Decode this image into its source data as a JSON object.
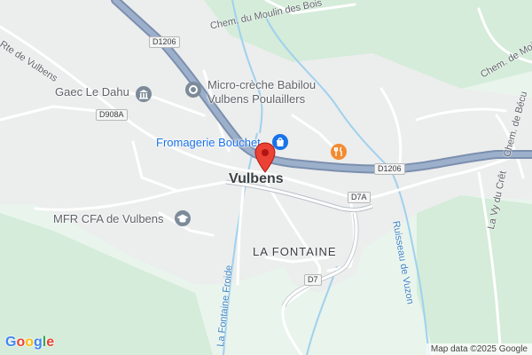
{
  "map": {
    "places": {
      "town": "Vulbens",
      "district": "LA FONTAINE"
    },
    "pois": {
      "gaec": "Gaec Le Dahu",
      "creche_line1": "Micro-crèche Babilou",
      "creche_line2": "Vulbens Poulaillers",
      "fromagerie": "Fromagerie Bouchet",
      "mfr": "MFR CFA de Vulbens"
    },
    "streets": {
      "rte_vulbens": "Rte de Vulbens",
      "moulin": "Chem. du Moulin des Bois",
      "moissey": "Chem. de Moissey",
      "becu": "Chem. de Bécu",
      "vy_cret": "La Vy du Crêt"
    },
    "waterways": {
      "ruisseau_vuzon": "Ruisseau de Vuzon",
      "fontaine_froide": "La Fontaine Froide"
    },
    "road_shields": {
      "d1206_top": "D1206",
      "d1206_right": "D1206",
      "d908a": "D908A",
      "d7a": "D7A",
      "d7": "D7"
    },
    "icons": {
      "gaec": "museum-icon",
      "creche": "place-icon",
      "fromagerie": "shopping-bag-icon",
      "restaurant": "restaurant-icon",
      "mfr": "school-icon",
      "pin": "location-pin-icon"
    },
    "colors": {
      "background": "#e8f4ec",
      "highway": "#8fa4c0",
      "pin": "#ea4335",
      "restaurant": "#f28b30",
      "water": "#7fc4e8"
    }
  },
  "branding": {
    "logo": "Google"
  },
  "attribution": "Map data ©2025 Google"
}
